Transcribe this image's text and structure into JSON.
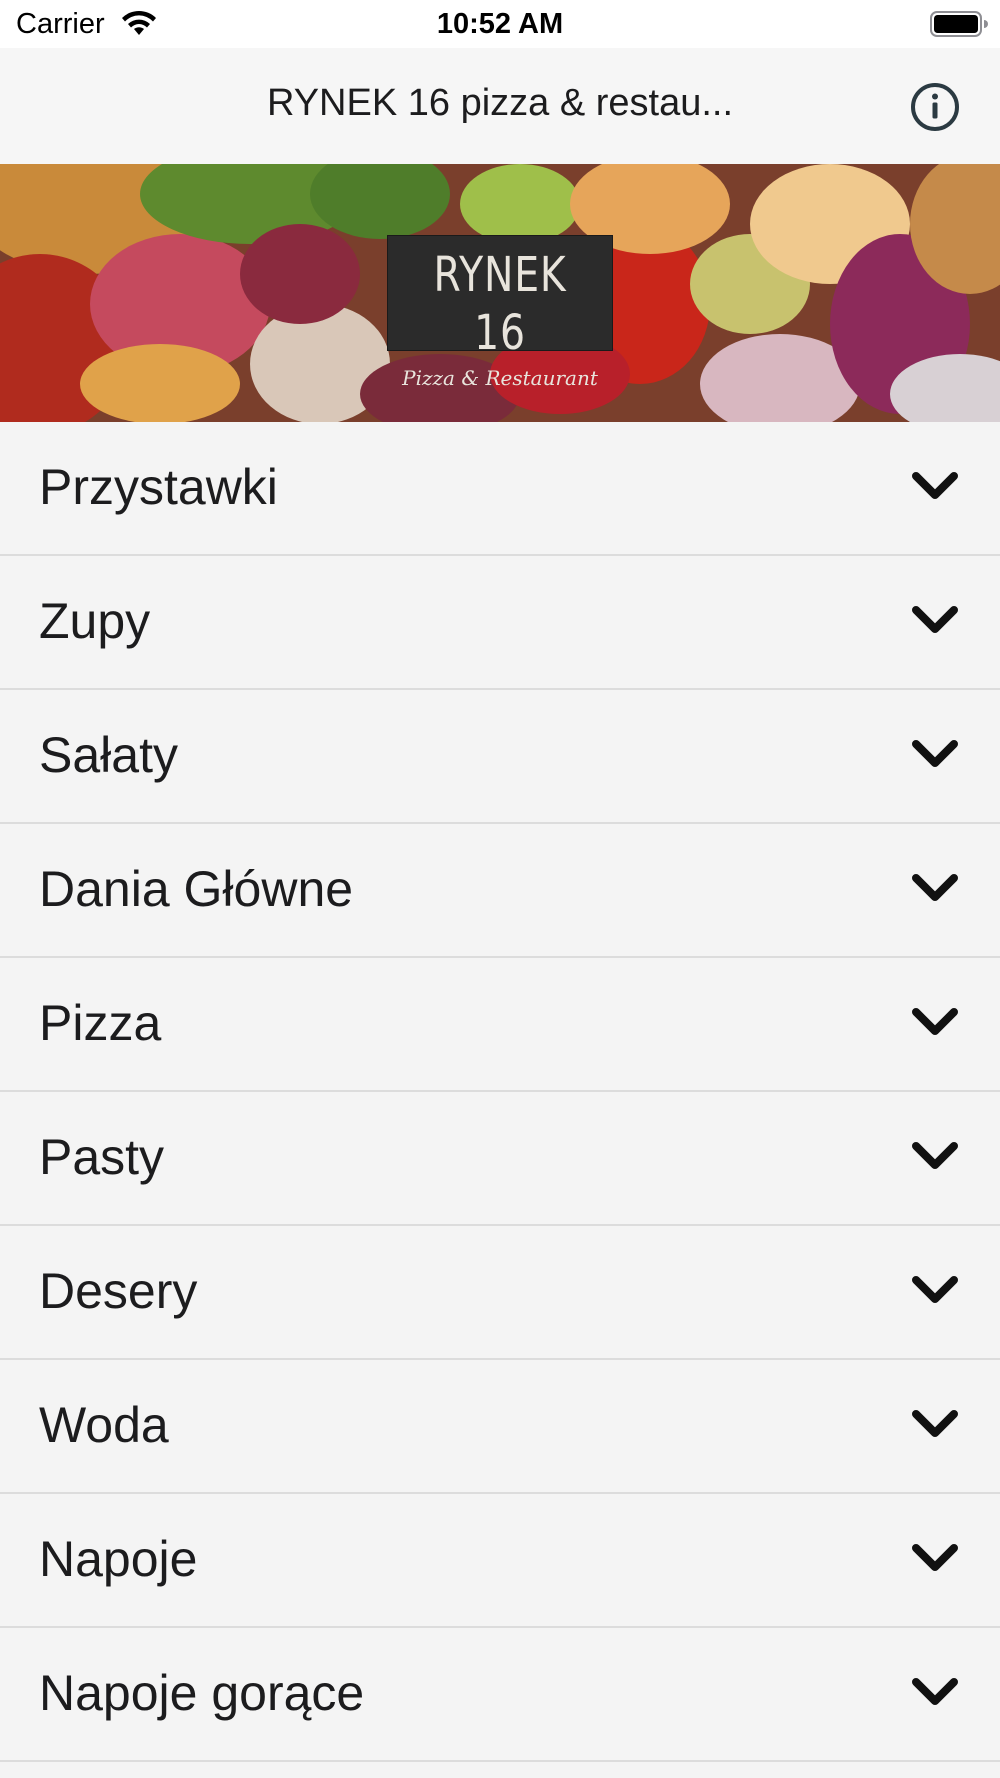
{
  "status_bar": {
    "carrier": "Carrier",
    "time": "10:52 AM",
    "wifi_icon": "wifi-icon",
    "battery_icon": "battery-icon"
  },
  "nav": {
    "title": "RYNEK 16 pizza & restau...",
    "info_icon": "info-icon"
  },
  "banner": {
    "logo_name": "RYNEK 16",
    "logo_tagline": "Pizza & Restaurant"
  },
  "menu": {
    "items": [
      {
        "label": "Przystawki"
      },
      {
        "label": "Zupy"
      },
      {
        "label": "Sałaty"
      },
      {
        "label": "Dania Główne"
      },
      {
        "label": "Pizza"
      },
      {
        "label": "Pasty"
      },
      {
        "label": "Desery"
      },
      {
        "label": "Woda"
      },
      {
        "label": "Napoje"
      },
      {
        "label": "Napoje gorące"
      }
    ],
    "chevron_icon": "chevron-down-icon"
  },
  "colors": {
    "background": "#f4f4f4",
    "nav_background": "#f6f6f6",
    "separator": "#dcdcdc",
    "text": "#1c1c1e",
    "logo_background": "#2b2b2b"
  }
}
